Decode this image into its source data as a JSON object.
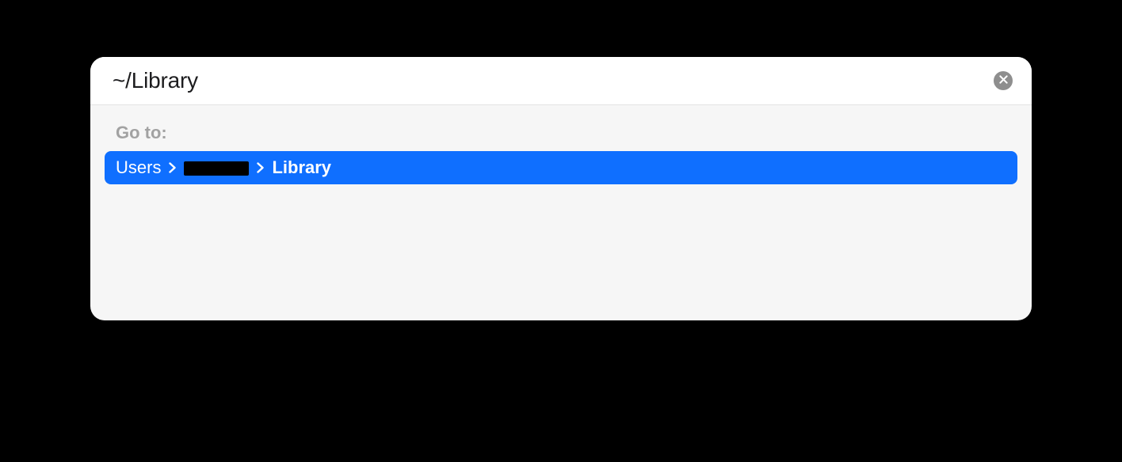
{
  "input": {
    "value": "~/Library"
  },
  "goto_label": "Go to:",
  "result": {
    "segments": [
      {
        "text": "Users",
        "redacted": false,
        "bold": false
      },
      {
        "text": "",
        "redacted": true,
        "bold": false
      },
      {
        "text": "Library",
        "redacted": false,
        "bold": true
      }
    ]
  },
  "colors": {
    "selection": "#0f6fff"
  }
}
